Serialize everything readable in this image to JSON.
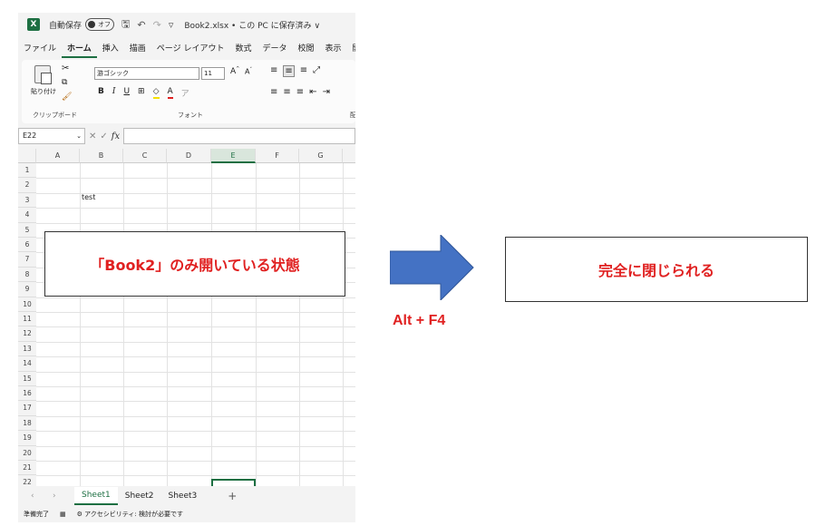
{
  "app": {
    "autosave_label": "自動保存",
    "toggle_state": "オフ",
    "filename": "Book2.xlsx • この PC に保存済み ∨"
  },
  "menu": [
    "ファイル",
    "ホーム",
    "挿入",
    "描画",
    "ページ レイアウト",
    "数式",
    "データ",
    "校閲",
    "表示",
    "開発"
  ],
  "ribbon": {
    "paste_label": "貼り付け",
    "clipboard_label": "クリップボード",
    "font_group_label": "フォント",
    "font_name": "游ゴシック",
    "font_size": "11",
    "grow_font": "A^",
    "shrink_font": "A˅",
    "bold": "B",
    "italic": "I",
    "underline": "U",
    "alignment_cut": "配"
  },
  "formula_bar": {
    "name_box": "E22",
    "fx": "fx"
  },
  "grid": {
    "columns": [
      "A",
      "B",
      "C",
      "D",
      "E",
      "F",
      "G"
    ],
    "rows": [
      "1",
      "2",
      "3",
      "4",
      "5",
      "6",
      "7",
      "8",
      "9",
      "10",
      "11",
      "12",
      "13",
      "14",
      "15",
      "16",
      "17",
      "18",
      "19",
      "20",
      "21",
      "22"
    ],
    "b2_value": "test"
  },
  "sheets": {
    "tabs": [
      "Sheet1",
      "Sheet2",
      "Sheet3"
    ],
    "add": "+"
  },
  "status": {
    "ready": "準備完了",
    "accessibility": "アクセシビリティ: 検討が必要です"
  },
  "annotation": {
    "left_text": "「Book2」のみ開いている状態",
    "keys": "Alt + F4",
    "right_text": "完全に閉じられる",
    "text_color": "#e02020",
    "arrow_color": "#4472c4"
  }
}
